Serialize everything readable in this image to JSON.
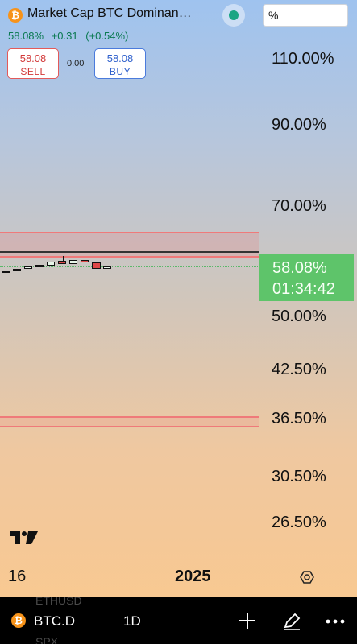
{
  "header": {
    "title": "Market Cap BTC Dominan…",
    "unit": "%",
    "last": "58.08%",
    "change": "+0.31",
    "change_pct": "(+0.54%)",
    "sell_value": "58.08",
    "sell_label": "SELL",
    "spread": "0.00",
    "buy_value": "58.08",
    "buy_label": "BUY",
    "status_color": "#1aa584"
  },
  "y_axis": {
    "labels": [
      "110.00%",
      "90.00%",
      "70.00%",
      "50.00%",
      "42.50%",
      "36.50%",
      "30.50%",
      "26.50%"
    ],
    "last_price": "58.08%",
    "countdown": "01:34:42"
  },
  "x_axis": {
    "labels": [
      "16",
      "2025"
    ]
  },
  "bottom_bar": {
    "symbol": "BTC.D",
    "interval": "1D",
    "ghost_items": [
      "ETHUSD",
      "SPX"
    ]
  },
  "icons": {
    "coin": "bitcoin-icon",
    "add": "plus-icon",
    "draw": "pen-icon",
    "more": "more-icon",
    "settings": "gear-icon",
    "logo": "tradingview-logo"
  }
}
